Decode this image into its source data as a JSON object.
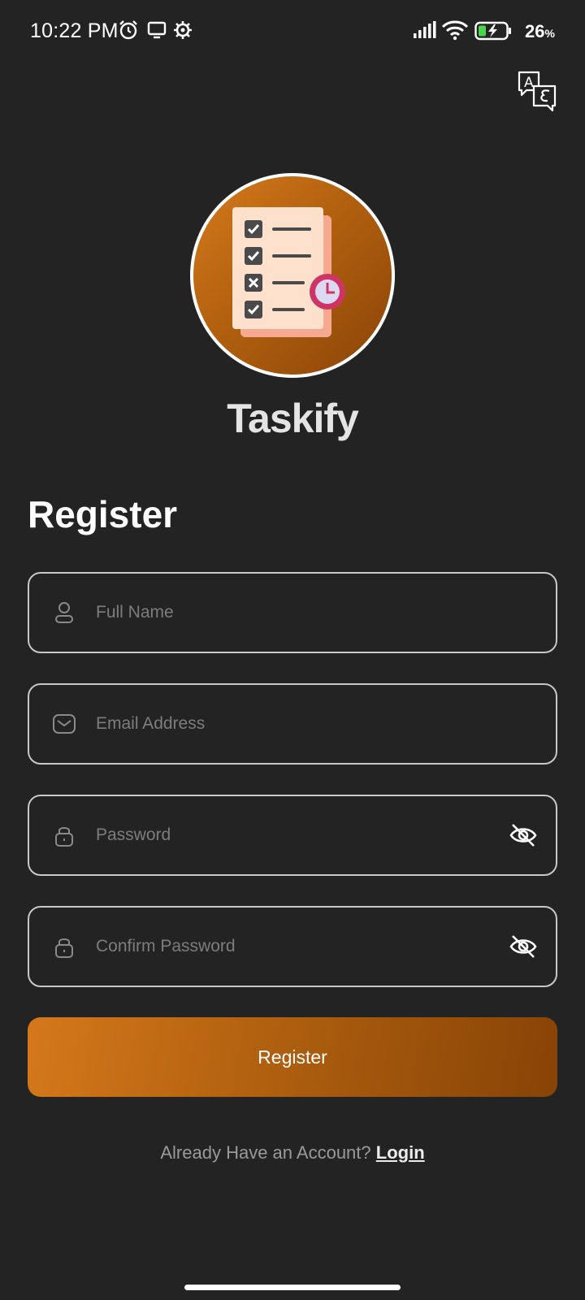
{
  "status_bar": {
    "time": "10:22 PM",
    "battery_percent": "26",
    "battery_unit": "%",
    "icons": [
      "alarm-icon",
      "screen-cast-icon",
      "settings-icon",
      "signal-icon",
      "wifi-icon",
      "battery-charging-icon"
    ]
  },
  "header": {
    "translate_icon": "translate-icon"
  },
  "brand": {
    "app_name": "Taskify",
    "logo_icon": "checklist-clock-icon"
  },
  "form": {
    "title": "Register",
    "full_name": {
      "placeholder": "Full Name",
      "value": "",
      "icon": "user-icon"
    },
    "email": {
      "placeholder": "Email Address",
      "value": "",
      "icon": "mail-icon"
    },
    "password": {
      "placeholder": "Password",
      "value": "",
      "icon": "lock-icon",
      "toggle_icon": "eye-off-icon"
    },
    "confirm_password": {
      "placeholder": "Confirm Password",
      "value": "",
      "icon": "lock-icon",
      "toggle_icon": "eye-off-icon"
    },
    "submit_label": "Register"
  },
  "footer": {
    "prompt": "Already Have an Account?",
    "login_label": "Login"
  },
  "colors": {
    "background": "#232323",
    "accent_start": "#d5781b",
    "accent_end": "#874306",
    "field_border": "#c7c7cc",
    "placeholder": "#7d7d7d"
  }
}
